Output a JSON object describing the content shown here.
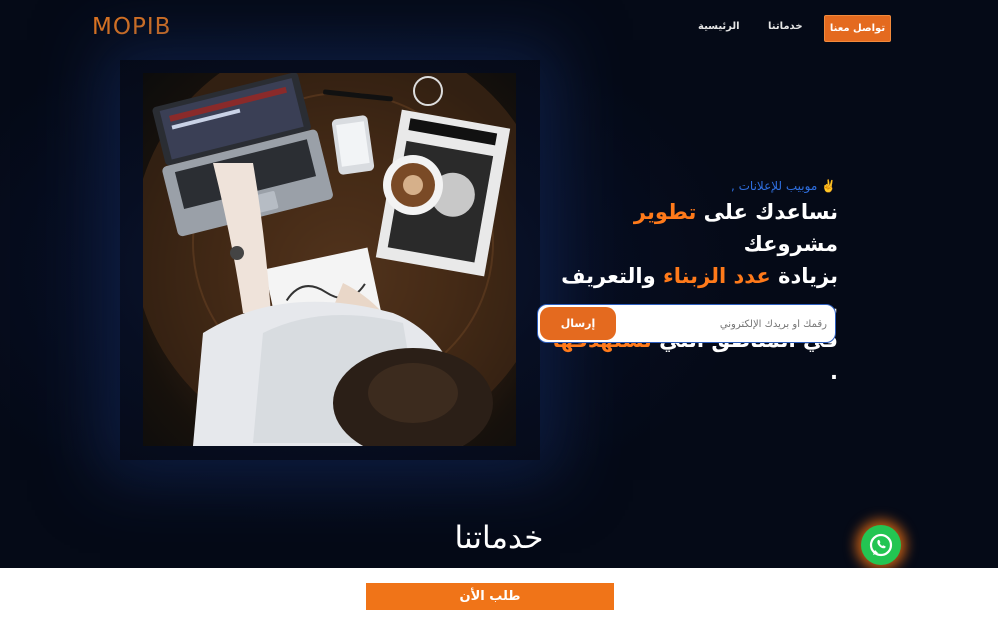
{
  "nav": {
    "logo": "MOPIB",
    "contact_label": "تواصل معنا",
    "services_label": "خدماتنا",
    "home_label": "الرئيسية"
  },
  "hero": {
    "tagline": "✌️ موبيب للإعلانات ,",
    "line1_a": "نساعدك على ",
    "line1_hl": "تطوير",
    "line1_b": " مشروعك",
    "line2_a": "بزيادة ",
    "line2_hl": "عدد الزبناء",
    "line2_b": " والتعريف به",
    "line3_a": "في المناطق التي ",
    "line3_hl": "تستهدفها",
    "line3_b": " .",
    "email_placeholder": "رقمك أو بريدك الإلكتروني",
    "send_label": "إرسال",
    "image_alt": "person working at desk with laptop and coffee"
  },
  "services": {
    "title": "خدماتنا"
  },
  "bottom_bar": {
    "order_label": "طلب الأن"
  },
  "colors": {
    "accent": "#e46a1f",
    "highlight": "#ff7a1a",
    "tagline": "#2f6fe0",
    "background": "#050a17",
    "whatsapp": "#23c552"
  },
  "icons": {
    "whatsapp": "whatsapp-icon"
  }
}
